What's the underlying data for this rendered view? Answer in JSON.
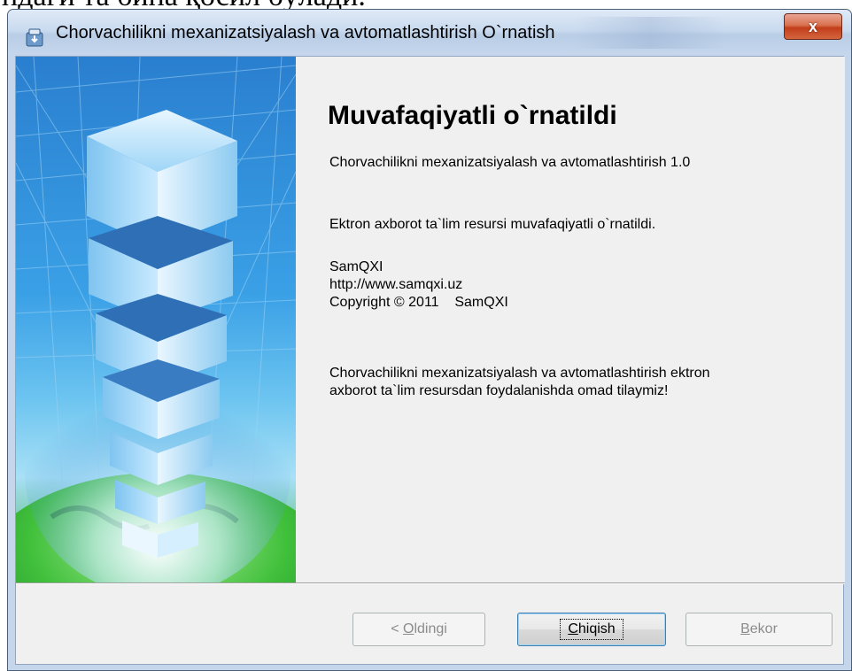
{
  "document": {
    "overlay_text": "ндаги та бина қосил бўлади."
  },
  "window": {
    "title": "Chorvachilikni mexanizatsiyalash va avtomatlashtirish O`rnatish",
    "close_glyph": "x"
  },
  "content": {
    "heading": "Muvafaqiyatli o`rnatildi",
    "product_line": "Chorvachilikni mexanizatsiyalash va avtomatlashtirish 1.0",
    "status_line": "Ektron axborot ta`lim resursi muvafaqiyatli o`rnatildi.",
    "company": "SamQXI",
    "website": "http://www.samqxi.uz",
    "copyright": "Copyright © 2011    SamQXI",
    "farewell_line1": "Chorvachilikni mexanizatsiyalash va avtomatlashtirish ektron",
    "farewell_line2": "axborot ta`lim resursdan foydalanishda omad tilaymiz!"
  },
  "buttons": {
    "back": {
      "prefix": "< ",
      "accel": "O",
      "rest": "ldingi",
      "enabled": false
    },
    "finish": {
      "accel": "C",
      "rest": "hiqish",
      "enabled": true
    },
    "cancel": {
      "accel": "B",
      "rest": "ekor",
      "enabled": false
    }
  },
  "colors": {
    "window_frame": "#c5d6ea",
    "close_button": "#c33d1a",
    "client_background": "#f0f0f0"
  },
  "icons": {
    "title": "installer-icon",
    "side_image": "building-globe-illustration"
  }
}
